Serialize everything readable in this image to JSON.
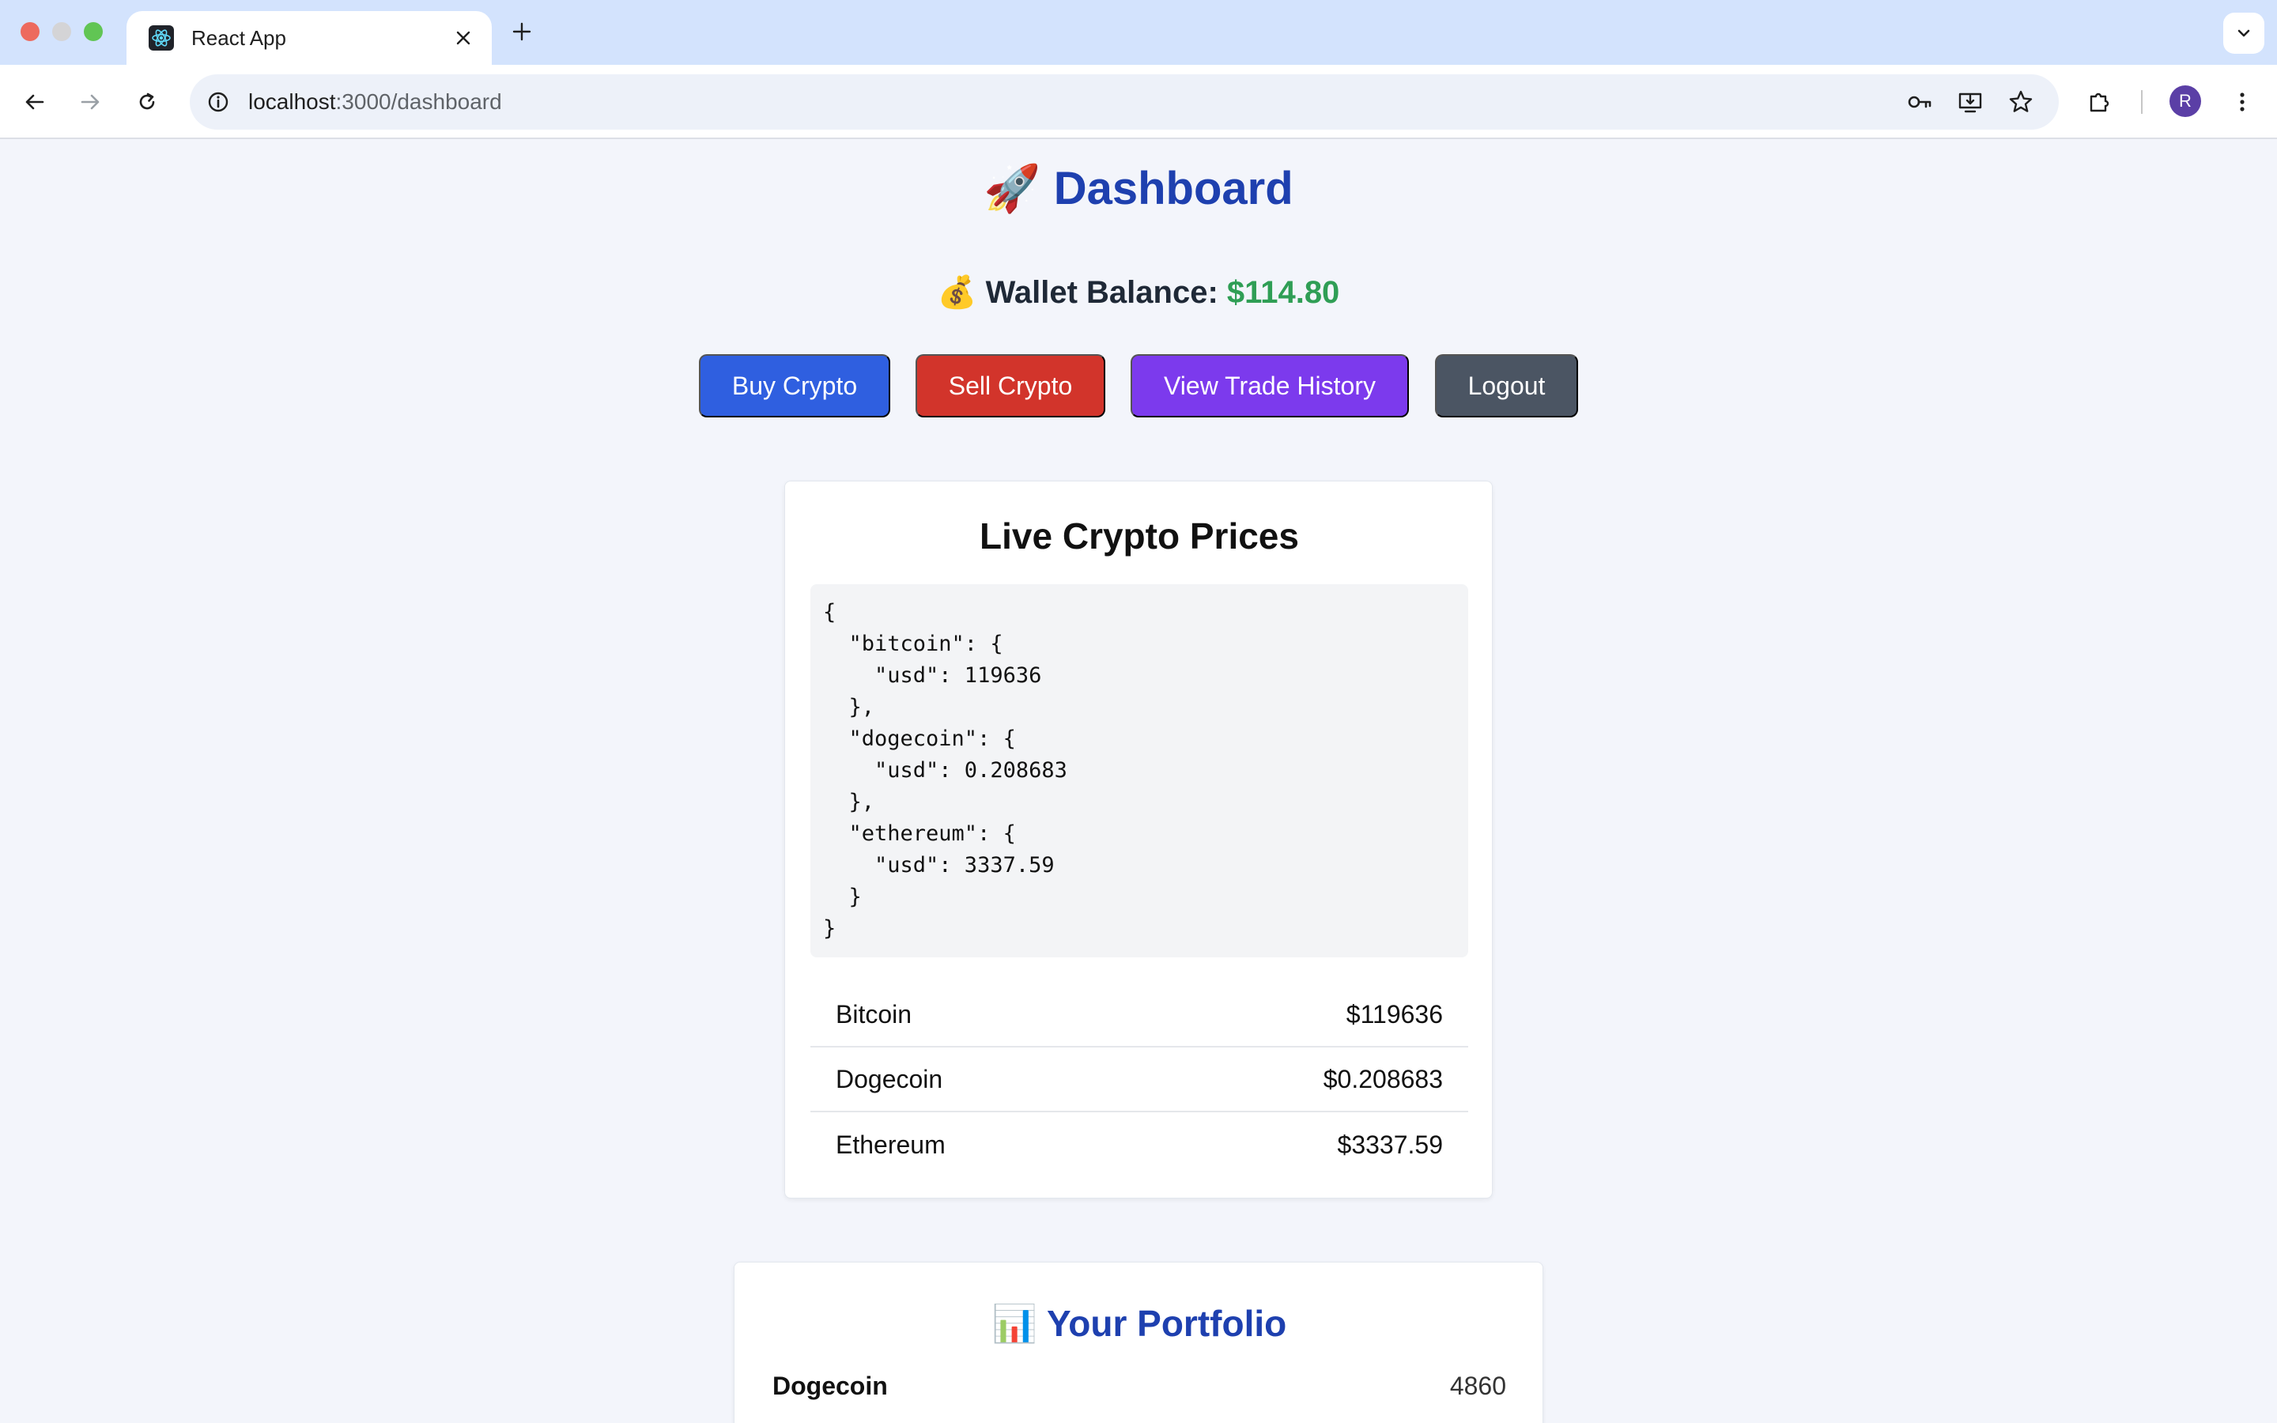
{
  "browser": {
    "tab_title": "React App",
    "url_host": "localhost",
    "url_rest": ":3000/dashboard",
    "profile_initial": "R"
  },
  "icons": {
    "back": "arrow-left-icon",
    "forward": "arrow-right-icon",
    "reload": "reload-icon",
    "site_info": "info-icon",
    "password": "key-icon",
    "install": "install-icon",
    "bookmark": "star-icon",
    "extensions": "puzzle-icon",
    "menu": "kebab-menu-icon"
  },
  "header": {
    "title_emoji": "🚀",
    "title": "Dashboard"
  },
  "wallet": {
    "emoji": "💰",
    "label": "Wallet Balance:",
    "amount": "$114.80"
  },
  "actions": {
    "buy": "Buy Crypto",
    "sell": "Sell Crypto",
    "history": "View Trade History",
    "logout": "Logout"
  },
  "prices_card": {
    "title": "Live Crypto Prices",
    "json_text": "{\n  \"bitcoin\": {\n    \"usd\": 119636\n  },\n  \"dogecoin\": {\n    \"usd\": 0.208683\n  },\n  \"ethereum\": {\n    \"usd\": 3337.59\n  }\n}",
    "rows": [
      {
        "name": "Bitcoin",
        "price": "$119636"
      },
      {
        "name": "Dogecoin",
        "price": "$0.208683"
      },
      {
        "name": "Ethereum",
        "price": "$3337.59"
      }
    ]
  },
  "portfolio": {
    "emoji": "📊",
    "title": "Your Portfolio",
    "rows": [
      {
        "name": "Dogecoin",
        "qty": "4860"
      }
    ]
  },
  "colors": {
    "primary": "#1e40af",
    "balance": "#2f9e55",
    "buy": "#2f5fe0",
    "sell": "#d2342b",
    "history": "#7c3aed",
    "logout": "#4b5563"
  }
}
